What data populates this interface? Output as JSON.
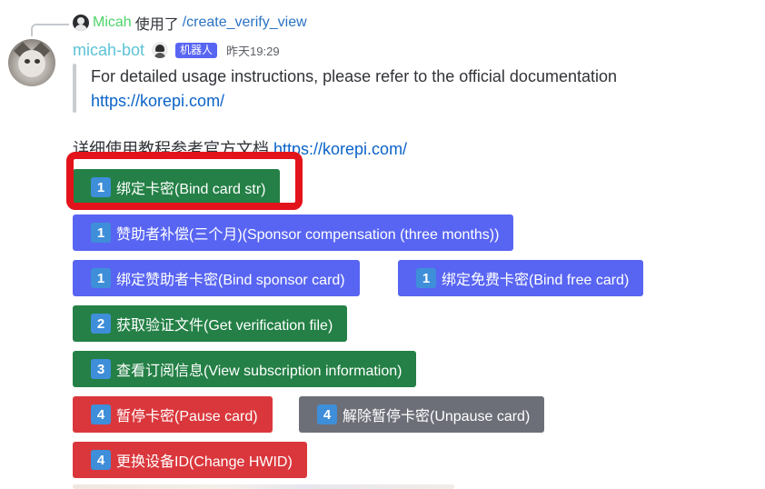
{
  "reply": {
    "username": "Micah",
    "used_text": "使用了",
    "command": "/create_verify_view"
  },
  "message": {
    "username": "micah-bot",
    "bot_badge": "机器人",
    "timestamp": "昨天19:29"
  },
  "embed": {
    "line1": "For detailed usage instructions, please refer to the official documentation",
    "link": "https://korepi.com/"
  },
  "chinese_line": {
    "text": "详细使用教程参考官方文档 ",
    "link": "https://korepi.com/"
  },
  "buttons": [
    {
      "emoji": "1",
      "label": "绑定卡密(Bind card str)",
      "style": "green"
    },
    {
      "emoji": "1",
      "label": "赞助者补偿(三个月)(Sponsor compensation (three months))",
      "style": "blurple"
    },
    {
      "emoji": "1",
      "label": "绑定赞助者卡密(Bind sponsor card)",
      "style": "blurple"
    },
    {
      "emoji": "1",
      "label": "绑定免费卡密(Bind free card)",
      "style": "blurple"
    },
    {
      "emoji": "2",
      "label": "获取验证文件(Get verification file)",
      "style": "green"
    },
    {
      "emoji": "3",
      "label": "查看订阅信息(View subscription information)",
      "style": "green"
    },
    {
      "emoji": "4",
      "label": "暂停卡密(Pause card)",
      "style": "red"
    },
    {
      "emoji": "4",
      "label": "解除暂停卡密(Unpause card)",
      "style": "grey"
    },
    {
      "emoji": "4",
      "label": "更换设备ID(Change HWID)",
      "style": "red"
    }
  ],
  "colors": {
    "green": "#248046",
    "blurple": "#5865f2",
    "red": "#da373c",
    "grey": "#6d6f78",
    "highlight": "#e3131b",
    "link": "#0b63c8"
  }
}
